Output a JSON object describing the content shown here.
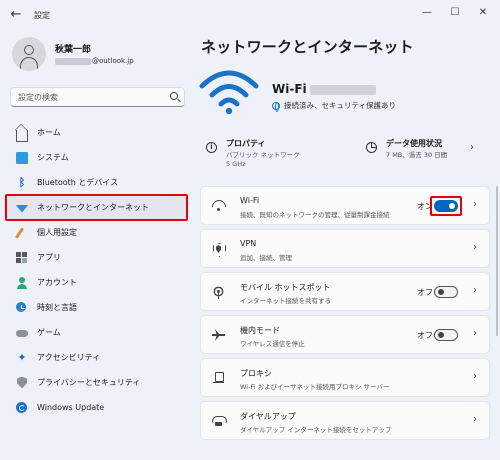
{
  "window": {
    "title": "設定",
    "back": "←",
    "minimize": "—",
    "maximize": "☐",
    "close": "✕"
  },
  "user": {
    "name": "秋葉一郎",
    "email_suffix": "@outlook.jp"
  },
  "search": {
    "placeholder": "設定の検索"
  },
  "sidebar": {
    "items": [
      {
        "label": "ホーム",
        "icon": "home-icon"
      },
      {
        "label": "システム",
        "icon": "system-icon"
      },
      {
        "label": "Bluetooth とデバイス",
        "icon": "bluetooth-icon"
      },
      {
        "label": "ネットワークとインターネット",
        "icon": "network-icon",
        "active": true
      },
      {
        "label": "個人用設定",
        "icon": "brush-icon"
      },
      {
        "label": "アプリ",
        "icon": "apps-icon"
      },
      {
        "label": "アカウント",
        "icon": "account-icon"
      },
      {
        "label": "時刻と言語",
        "icon": "time-language-icon"
      },
      {
        "label": "ゲーム",
        "icon": "gaming-icon"
      },
      {
        "label": "アクセシビリティ",
        "icon": "accessibility-icon"
      },
      {
        "label": "プライバシーとセキュリティ",
        "icon": "shield-icon"
      },
      {
        "label": "Windows Update",
        "icon": "windows-update-icon"
      }
    ]
  },
  "main": {
    "title": "ネットワークとインターネット",
    "wifi_name": "Wi-Fi",
    "wifi_status": "接続済み、セキュリティ保護あり",
    "properties": {
      "title": "プロパティ",
      "line1": "パブリック ネットワーク",
      "line2": "5 GHz"
    },
    "data_usage": {
      "title": "データ使用状況",
      "sub": "7 MB、過去 30 日間"
    },
    "cards": [
      {
        "title": "Wi-Fi",
        "sub": "接続、既知のネットワークの管理、従量制課金接続",
        "state": "オン",
        "toggle": true,
        "on": true
      },
      {
        "title": "VPN",
        "sub": "追加、接続、管理",
        "state": "",
        "toggle": false
      },
      {
        "title": "モバイル ホットスポット",
        "sub": "インターネット接続を共有する",
        "state": "オフ",
        "toggle": true,
        "on": false
      },
      {
        "title": "機内モード",
        "sub": "ワイヤレス通信を停止",
        "state": "オフ",
        "toggle": true,
        "on": false
      },
      {
        "title": "プロキシ",
        "sub": "Wi-Fi およびイーサネット接続用プロキシ サーバー",
        "state": "",
        "toggle": false
      },
      {
        "title": "ダイヤルアップ",
        "sub": "ダイヤルアップ インターネット接続をセットアップ",
        "state": "",
        "toggle": false
      }
    ]
  },
  "colors": {
    "accent": "#0067c0",
    "highlight": "#e3000f",
    "wifi_blue": "#1a73c9"
  }
}
